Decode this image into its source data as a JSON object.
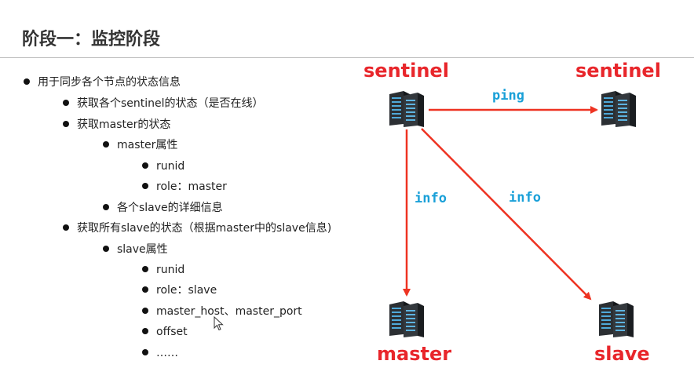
{
  "slide": {
    "title": "阶段一：监控阶段"
  },
  "bullets": [
    {
      "level": 0,
      "text": "用于同步各个节点的状态信息"
    },
    {
      "level": 1,
      "text": "获取各个sentinel的状态（是否在线）"
    },
    {
      "level": 1,
      "text": "获取master的状态"
    },
    {
      "level": 2,
      "text": "master属性"
    },
    {
      "level": 3,
      "text": "runid"
    },
    {
      "level": 3,
      "text": "role：master"
    },
    {
      "level": 2,
      "text": "各个slave的详细信息"
    },
    {
      "level": 1,
      "text": "获取所有slave的状态（根据master中的slave信息)"
    },
    {
      "level": 2,
      "text": "slave属性"
    },
    {
      "level": 3,
      "text": "runid"
    },
    {
      "level": 3,
      "text": "role：slave"
    },
    {
      "level": 3,
      "text": "master_host、master_port"
    },
    {
      "level": 3,
      "text": "offset"
    },
    {
      "level": 3,
      "text": "……"
    }
  ],
  "diagram": {
    "nodes": {
      "sentinel_main": "sentinel",
      "sentinel_peer": "sentinel",
      "master": "master",
      "slave": "slave"
    },
    "edges": {
      "ping": "ping",
      "info_master": "info",
      "info_slave": "info"
    },
    "colors": {
      "node_label": "#e8262b",
      "arrow": "#ee3322",
      "edge_label": "#1aa0d8"
    },
    "icons": {
      "server": "server-rack-icon"
    }
  }
}
